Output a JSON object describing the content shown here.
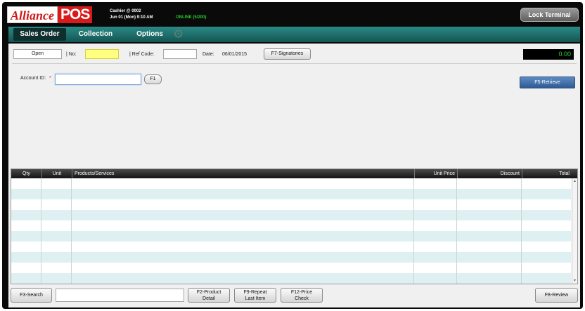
{
  "header": {
    "logo_left": "Alliance",
    "logo_right": "POS",
    "user_line": "Cashier @ 0002",
    "datetime_line": "Jun 01 (Mon) 9:10 AM",
    "online_status": "ONLINE (5/200)",
    "lock_button": "Lock Terminal"
  },
  "nav": {
    "tabs": [
      {
        "label": "Sales Order",
        "active": true
      },
      {
        "label": "Collection",
        "active": false
      },
      {
        "label": "Options",
        "active": false
      }
    ],
    "gear_icon": "gear-icon"
  },
  "order_bar": {
    "status_value": "Open",
    "no_label": "| No:",
    "no_value": "",
    "ref_label": "| Ref Code:",
    "ref_value": "",
    "date_label": "Date:",
    "date_value": "06/01/2015",
    "signatories_button": "F7-Signatories",
    "total_display": "0.00"
  },
  "account": {
    "label": "Account ID:",
    "required_marker": "*",
    "value": "",
    "lookup_button": "F1",
    "retrieve_button": "F5-Retrieve"
  },
  "table": {
    "columns": [
      "Qty",
      "Unit",
      "Products/Services",
      "Unit Price",
      "Discount",
      "Total"
    ],
    "rows": 10
  },
  "footer": {
    "search_button": "F3-Search",
    "search_value": "",
    "product_detail_line1": "F2-Product",
    "product_detail_line2": "Detail",
    "repeat_line1": "F9-Repeat",
    "repeat_line2": "Last Item",
    "price_check_line1": "F12-Price",
    "price_check_line2": "Check",
    "review_button": "F8-Review"
  },
  "colors": {
    "nav_teal": "#1e6e6b",
    "logo_red": "#d81a1a",
    "online_green": "#24c92a",
    "row_band": "#dff0f2",
    "retrieve_blue": "#3a6aa6",
    "no_field_yellow": "#ffff80"
  }
}
